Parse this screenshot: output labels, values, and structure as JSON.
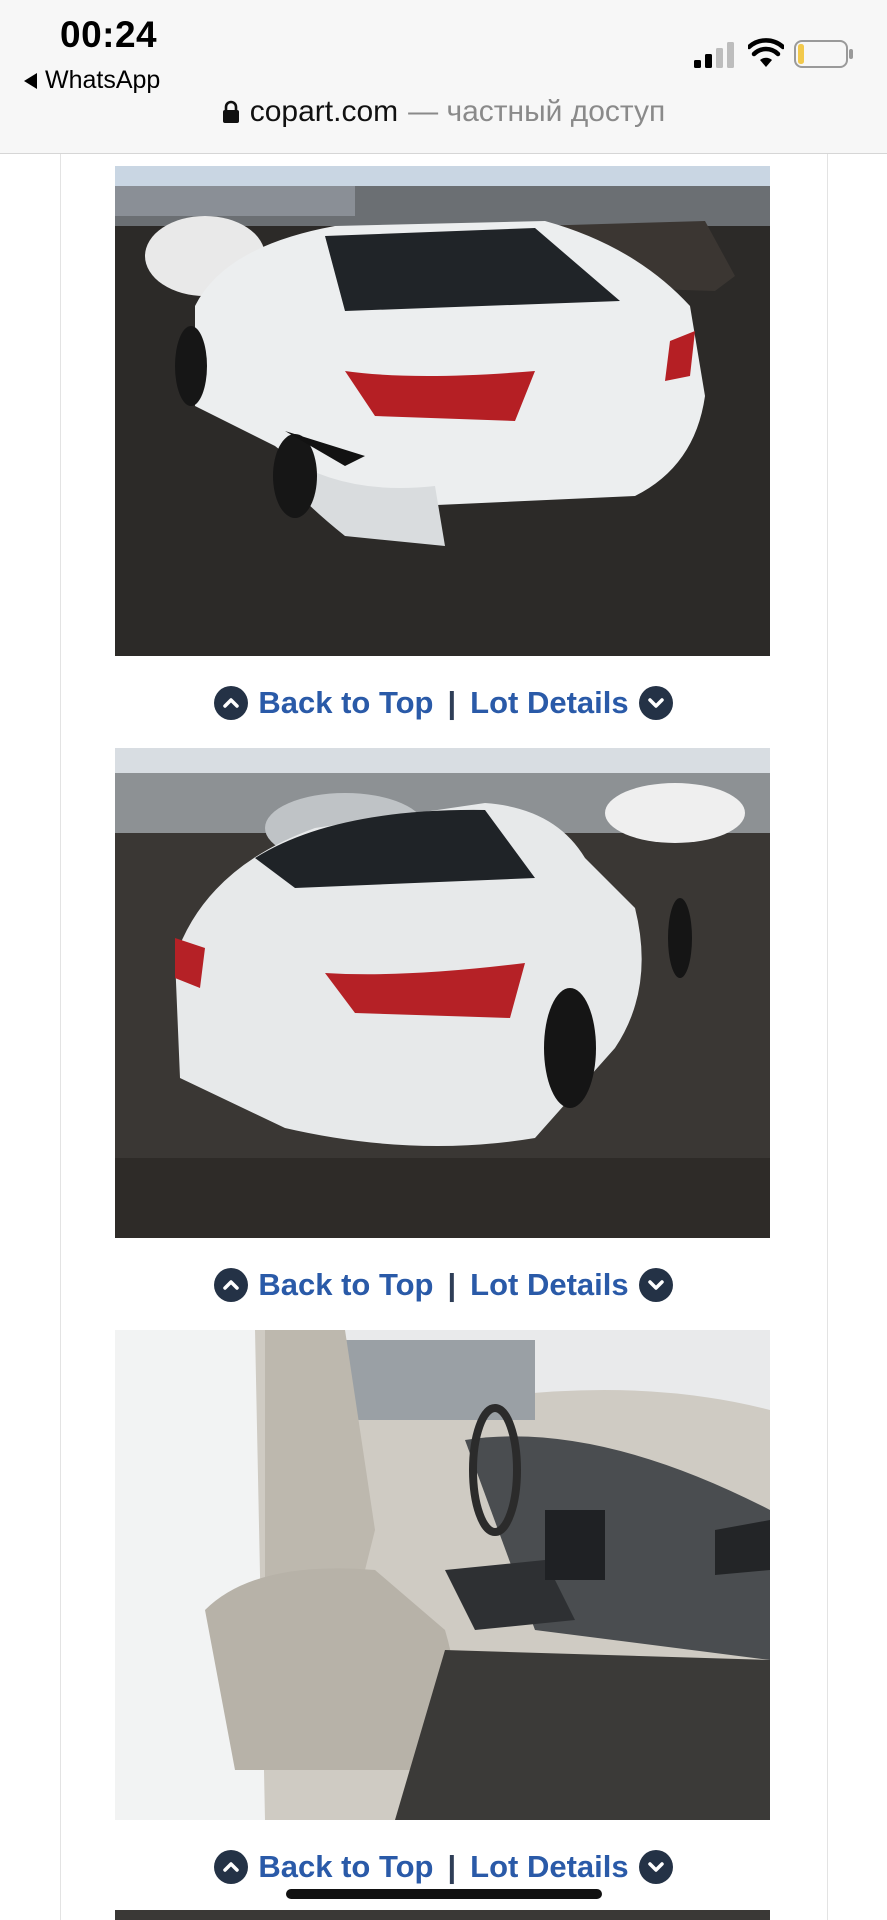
{
  "status_bar": {
    "time": "00:24",
    "back_app": "WhatsApp"
  },
  "address_bar": {
    "domain": "copart.com",
    "access_note": "— частный доступ"
  },
  "nav": {
    "back_to_top": "Back to Top",
    "separator": "|",
    "lot_details": "Lot Details"
  },
  "photos": [
    {
      "icon": "car-rear-right-photo"
    },
    {
      "icon": "car-rear-left-photo"
    },
    {
      "icon": "car-interior-photo"
    }
  ],
  "colors": {
    "link": "#2a5aa8",
    "icon_circle": "#243246"
  }
}
